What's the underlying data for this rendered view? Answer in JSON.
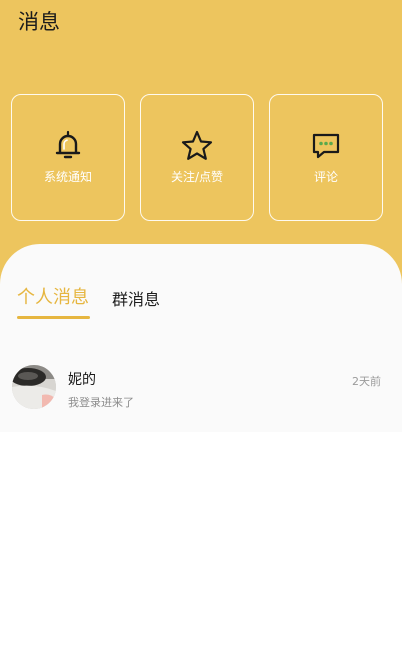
{
  "colors": {
    "header_bg": "#edc55e",
    "accent": "#e6b640",
    "card_border": "#ffffff"
  },
  "header": {
    "title": "消息"
  },
  "cards": [
    {
      "label": "系统通知",
      "icon": "bell-icon"
    },
    {
      "label": "关注/点赞",
      "icon": "star-icon"
    },
    {
      "label": "评论",
      "icon": "comment-icon"
    }
  ],
  "tabs": [
    {
      "label": "个人消息",
      "active": true
    },
    {
      "label": "群消息",
      "active": false
    }
  ],
  "messages": [
    {
      "name": "妮的",
      "preview": "我登录进来了",
      "time": "2天前",
      "avatar": "avatar-photo"
    }
  ]
}
